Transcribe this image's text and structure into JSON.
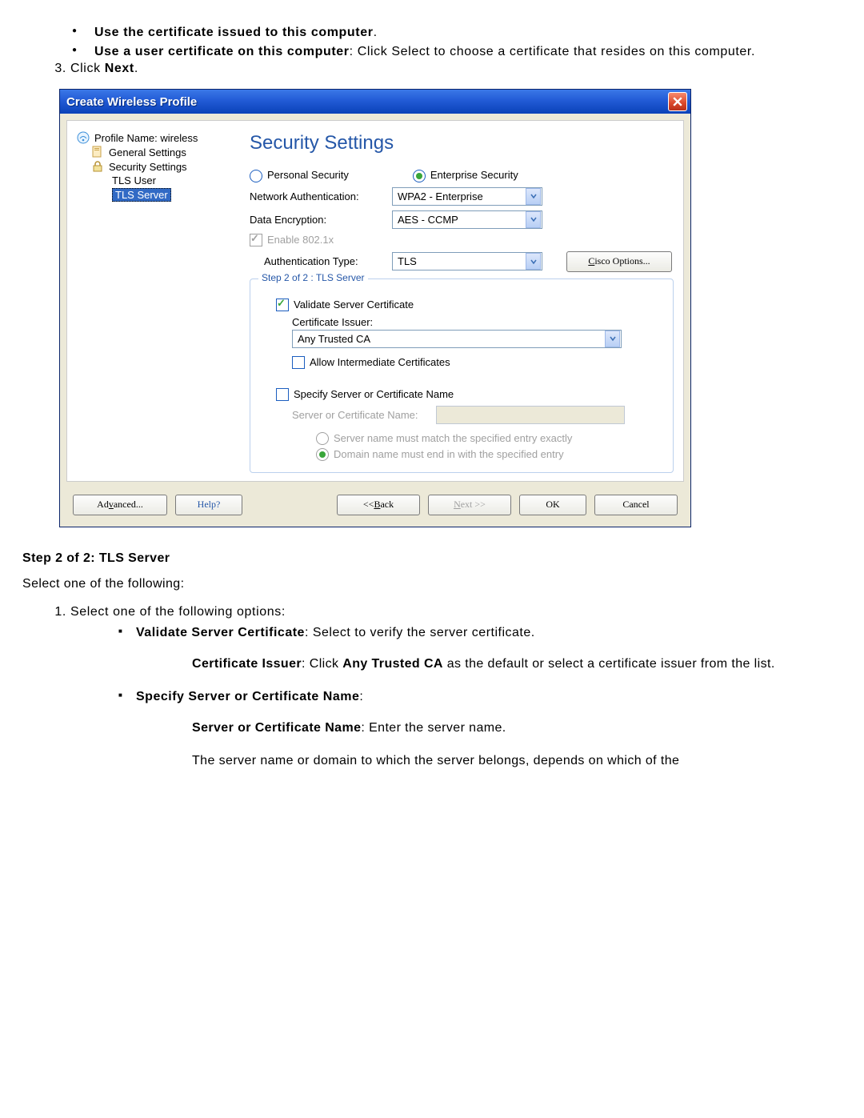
{
  "top_bullets": [
    {
      "bold": "Use the certificate issued to this computer",
      "rest": "."
    },
    {
      "bold": "Use a user certificate on this computer",
      "rest": ": Click Select to choose a certificate that resides on this computer."
    }
  ],
  "step3_prefix": "Click ",
  "step3_bold": "Next",
  "step3_suffix": ".",
  "window": {
    "title": "Create Wireless Profile",
    "tree": {
      "profile_label": "Profile Name: wireless",
      "general": "General Settings",
      "security": "Security Settings",
      "tls_user": "TLS User",
      "tls_server": "TLS Server"
    },
    "header": "Security Settings",
    "radio_personal": "Personal Security",
    "radio_enterprise": "Enterprise Security",
    "net_auth_lbl": "Network Authentication:",
    "net_auth_val": "WPA2 - Enterprise",
    "data_enc_lbl": "Data Encryption:",
    "data_enc_val": "AES - CCMP",
    "enable_8021x": "Enable 802.1x",
    "auth_type_lbl": "Authentication Type:",
    "auth_type_val": "TLS",
    "cisco_btn": "Cisco Options...",
    "cisco_ul": "C",
    "step_title": "Step 2 of 2 : TLS Server",
    "validate_lbl": "Validate Server Certificate",
    "cert_issuer_lbl": "Certificate Issuer:",
    "cert_issuer_val": "Any Trusted CA",
    "allow_int_lbl": "Allow Intermediate Certificates",
    "specify_lbl": "Specify Server or Certificate Name",
    "serv_name_lbl": "Server or Certificate Name:",
    "match_exact": "Server name must match the specified entry exactly",
    "match_domain": "Domain name must end in with the specified entry",
    "buttons": {
      "advanced": "Advanced...",
      "adv_ul": "v",
      "help": "Help?",
      "back": "<< Back",
      "back_ul": "B",
      "next": "Next >>",
      "next_ul": "N",
      "ok": "OK",
      "cancel": "Cancel"
    }
  },
  "below": {
    "heading": "Step 2 of 2: TLS Server",
    "intro": "Select one of the following:",
    "step1": "Select one of the following options:",
    "b1_bold": "Validate Server Certificate",
    "b1_rest": ": Select to verify the server certificate.",
    "b1_sub_bold": "Certificate Issuer",
    "b1_sub_mid": ": Click ",
    "b1_sub_bold2": "Any Trusted CA",
    "b1_sub_rest": " as the default or select a certificate issuer from the list.",
    "b2_bold": "Specify Server or Certificate Name",
    "b2_rest": ":",
    "b2_sub1_bold": "Server or Certificate Name",
    "b2_sub1_rest": ": Enter the server name.",
    "b2_sub2": "The server name or domain to which the server belongs, depends on which of the"
  }
}
